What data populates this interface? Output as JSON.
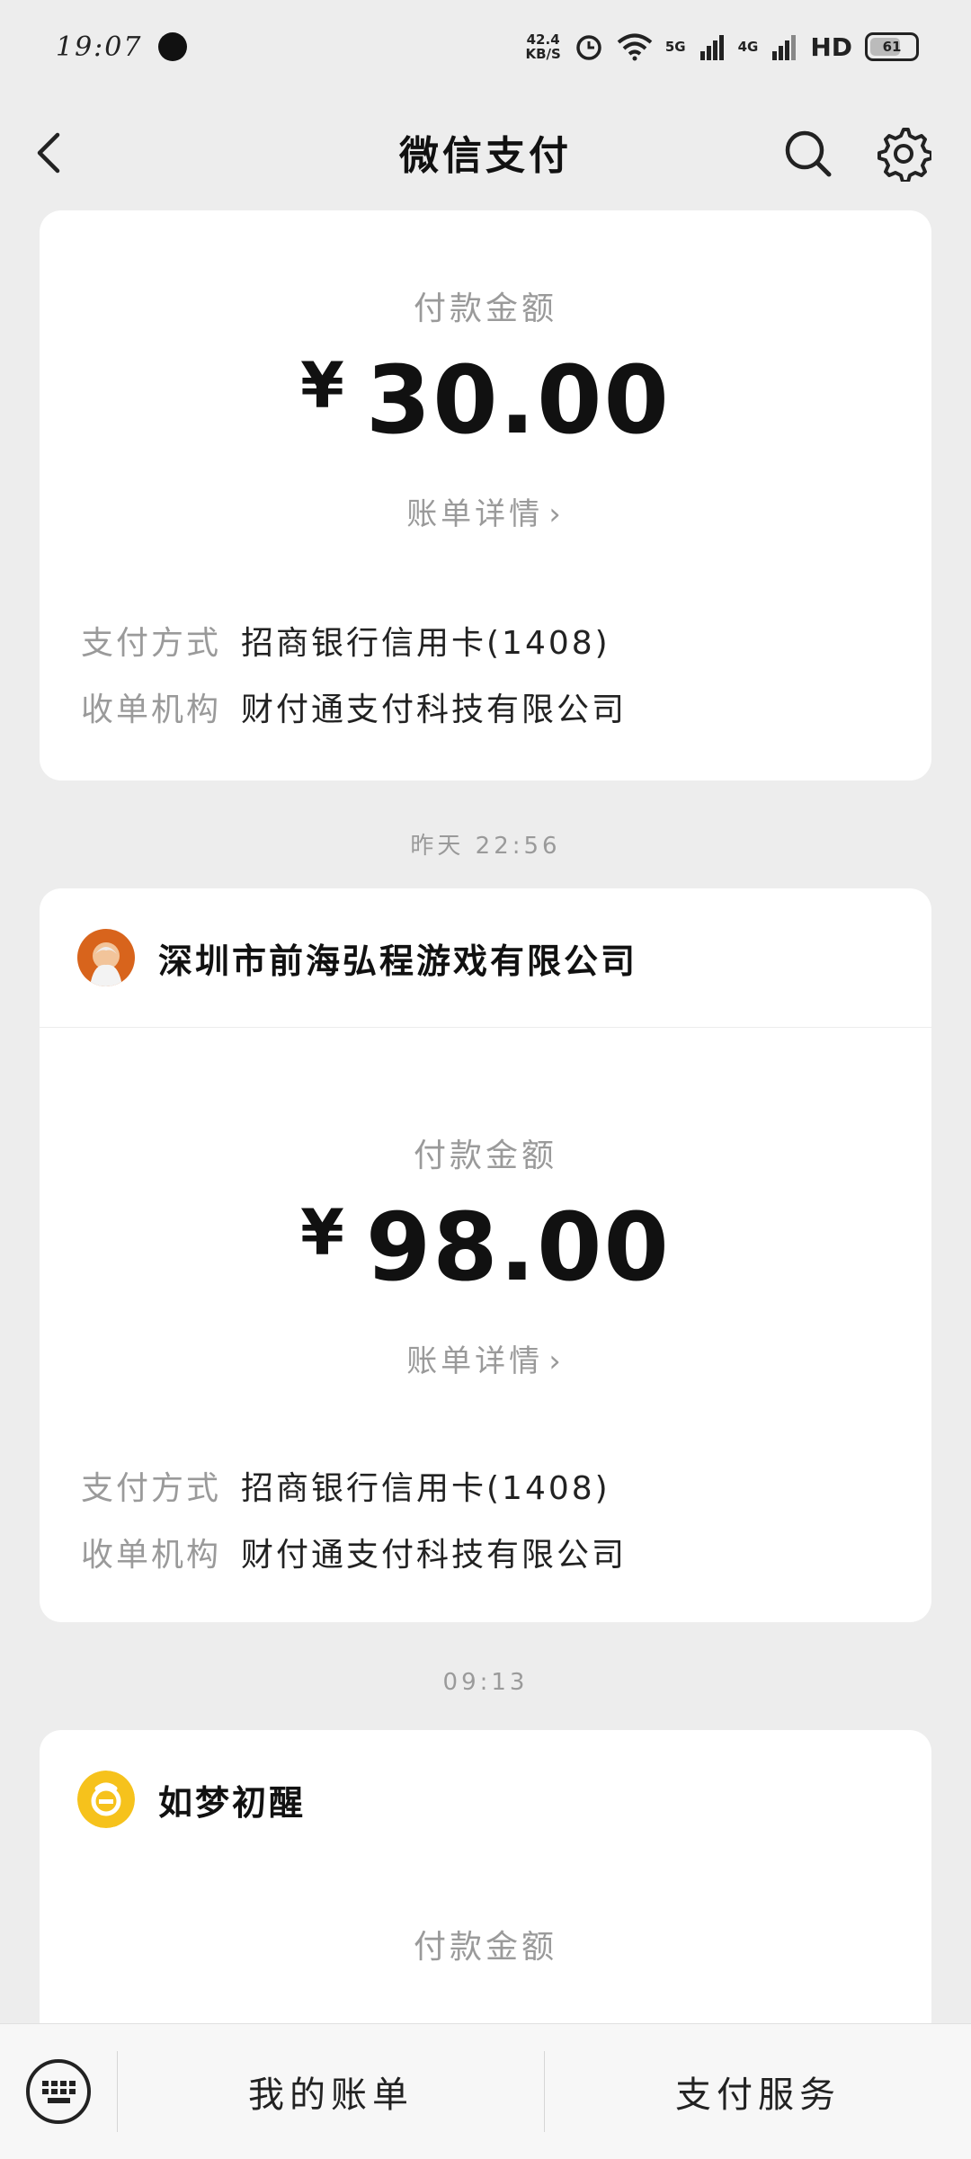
{
  "status_bar": {
    "time": "19:07",
    "net_speed_value": "42.4",
    "net_speed_unit": "KB/S",
    "network_5g": "5G",
    "network_4g": "4G",
    "hd": "HD",
    "battery": "61"
  },
  "navbar": {
    "title": "微信支付"
  },
  "transactions": [
    {
      "amount_label": "付款金额",
      "currency": "¥",
      "amount": "30.00",
      "detail_link": "账单详情",
      "payment_method_label": "支付方式",
      "payment_method": "招商银行信用卡(1408)",
      "acquirer_label": "收单机构",
      "acquirer": "财付通支付科技有限公司"
    },
    {
      "timestamp": "昨天 22:56",
      "merchant": "深圳市前海弘程游戏有限公司",
      "amount_label": "付款金额",
      "currency": "¥",
      "amount": "98.00",
      "detail_link": "账单详情",
      "payment_method_label": "支付方式",
      "payment_method": "招商银行信用卡(1408)",
      "acquirer_label": "收单机构",
      "acquirer": "财付通支付科技有限公司"
    },
    {
      "timestamp": "09:13",
      "merchant": "如梦初醒",
      "amount_label": "付款金额"
    }
  ],
  "bottom_bar": {
    "my_bills": "我的账单",
    "pay_services": "支付服务"
  }
}
